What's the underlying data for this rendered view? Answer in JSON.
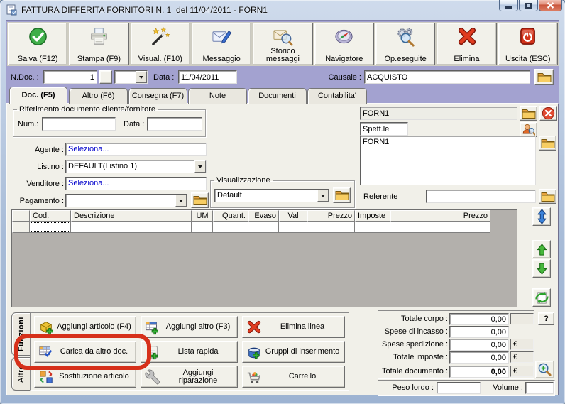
{
  "window": {
    "title": "FATTURA DIFFERITA FORNITORI N. 1  del 11/04/2011 - FORN1"
  },
  "toolbar": {
    "buttons": [
      {
        "label": "Salva (F12)",
        "icon": "save-check-icon"
      },
      {
        "label": "Stampa (F9)",
        "icon": "printer-icon"
      },
      {
        "label": "Visual. (F10)",
        "icon": "magic-wand-icon"
      },
      {
        "label": "Messaggio",
        "icon": "message-envelope-pen-icon"
      },
      {
        "label": "Storico messaggi",
        "icon": "message-history-icon"
      },
      {
        "label": "Navigatore",
        "icon": "compass-icon"
      },
      {
        "label": "Op.eseguite",
        "icon": "gears-search-icon"
      },
      {
        "label": "Elimina",
        "icon": "red-x-icon"
      },
      {
        "label": "Uscita (ESC)",
        "icon": "power-icon"
      }
    ]
  },
  "doc_row": {
    "ndoc_label": "N.Doc. :",
    "ndoc_value": "1",
    "serie_value": "",
    "data_label": "Data :",
    "data_value": "11/04/2011",
    "causale_label": "Causale :",
    "causale_value": "ACQUISTO"
  },
  "tabs": [
    {
      "label": "Doc. (F5)"
    },
    {
      "label": "Altro (F6)"
    },
    {
      "label": "Consegna (F7)"
    },
    {
      "label": "Note"
    },
    {
      "label": "Documenti"
    },
    {
      "label": "Contabilita'"
    }
  ],
  "reference_group": {
    "legend": "Riferimento documento cliente/fornitore",
    "num_label": "Num.:",
    "num_value": "",
    "date_label": "Data :",
    "date_value": ""
  },
  "form": {
    "agente_label": "Agente :",
    "agente_value": "Seleziona...",
    "listino_label": "Listino :",
    "listino_value": "DEFAULT(Listino 1)",
    "venditore_label": "Venditore :",
    "venditore_value": "Seleziona...",
    "pagamento_label": "Pagamento :",
    "pagamento_value": ""
  },
  "visualizzazione": {
    "legend": "Visualizzazione",
    "value": "Default"
  },
  "customer": {
    "code": "FORN1",
    "salutation": "Spett.le",
    "address": "FORN1",
    "referente_label": "Referente",
    "referente_value": ""
  },
  "grid": {
    "headers": [
      "",
      "Cod.",
      "Descrizione",
      "UM",
      "Quant.",
      "Evaso",
      "Val",
      "Prezzo",
      "Imposte",
      "Prezzo"
    ]
  },
  "actions": {
    "side_tabs": [
      {
        "label": "Funzioni"
      },
      {
        "label": "Altro"
      }
    ],
    "items": [
      {
        "label": "Aggiungi articolo (F4)"
      },
      {
        "label": "Aggiungi altro (F3)"
      },
      {
        "label": "Elimina linea"
      },
      {
        "label": "Carica da altro doc."
      },
      {
        "label": "Lista rapida"
      },
      {
        "label": "Gruppi di inserimento"
      },
      {
        "label": "Sostituzione articolo"
      },
      {
        "label": "Aggiungi riparazione"
      },
      {
        "label": "Carrello"
      }
    ]
  },
  "totals": {
    "help_label": "?",
    "rows": [
      {
        "label": "Totale corpo :",
        "value": "0,00",
        "suffix": ""
      },
      {
        "label": "Spese di incasso :",
        "value": "0,00",
        "suffix": ""
      },
      {
        "label": "Spese spedizione :",
        "value": "0,00",
        "suffix": "€"
      },
      {
        "label": "Totale imposte :",
        "value": "0,00",
        "suffix": "€"
      },
      {
        "label": "Totale documento :",
        "value": "0,00",
        "suffix": "€"
      }
    ],
    "peso_label": "Peso lordo :",
    "peso_value": "",
    "volume_label": "Volume :",
    "volume_value": ""
  },
  "annotation": {
    "color": "#d6301a"
  }
}
